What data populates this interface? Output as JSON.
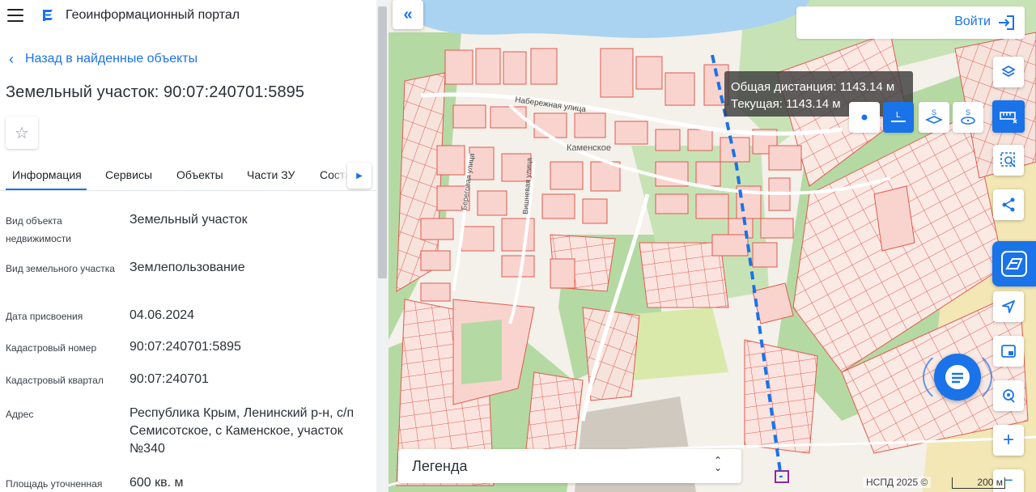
{
  "header": {
    "app_title": "Геоинформационный портал",
    "menu_icon": "hamburger-menu-icon",
    "logo_icon": "portal-logo-icon"
  },
  "navigation": {
    "back_label": "Назад в найденные объекты"
  },
  "object": {
    "title": "Земельный участок: 90:07:240701:5895",
    "favorite_icon": "star-icon"
  },
  "tabs": [
    {
      "label": "Информация",
      "active": true
    },
    {
      "label": "Сервисы",
      "active": false
    },
    {
      "label": "Объекты",
      "active": false
    },
    {
      "label": "Части ЗУ",
      "active": false
    },
    {
      "label": "Соста",
      "active": false
    }
  ],
  "info_rows": [
    {
      "label": "Вид объекта недвижимости",
      "value": "Земельный участок"
    },
    {
      "label": "Вид земельного участка",
      "value": "Землепользование"
    },
    {
      "label": "Дата присвоения",
      "value": "04.06.2024"
    },
    {
      "label": "Кадастровый номер",
      "value": "90:07:240701:5895"
    },
    {
      "label": "Кадастровый квартал",
      "value": "90:07:240701"
    },
    {
      "label": "Адрес",
      "value": "Республика Крым, Ленинский р-н, с/п Семисотское, с Каменское, участок №340"
    },
    {
      "label": "Площадь уточненная",
      "value": "600 кв. м"
    }
  ],
  "map": {
    "login_label": "Войти",
    "tooltip_total": "Общая дистанция: 1143.14 м",
    "tooltip_current": "Текущая: 1143.14 м",
    "street_label": "Набережная улица",
    "street_label_2": "Береговая улица",
    "street_label_3": "Вишневая улица",
    "village_label": "Каменское",
    "tool_letters": {
      "line": "L",
      "area": "S",
      "circle": "S"
    },
    "legend_label": "Легенда",
    "attribution": "НСПД 2025 ©",
    "scale_label": "200 м",
    "colors": {
      "accent": "#1a73e8",
      "water": "#aad3f2",
      "parcel": "#e05a4e",
      "green": "#b5d9a3",
      "measure_line": "#1a73e8"
    }
  }
}
